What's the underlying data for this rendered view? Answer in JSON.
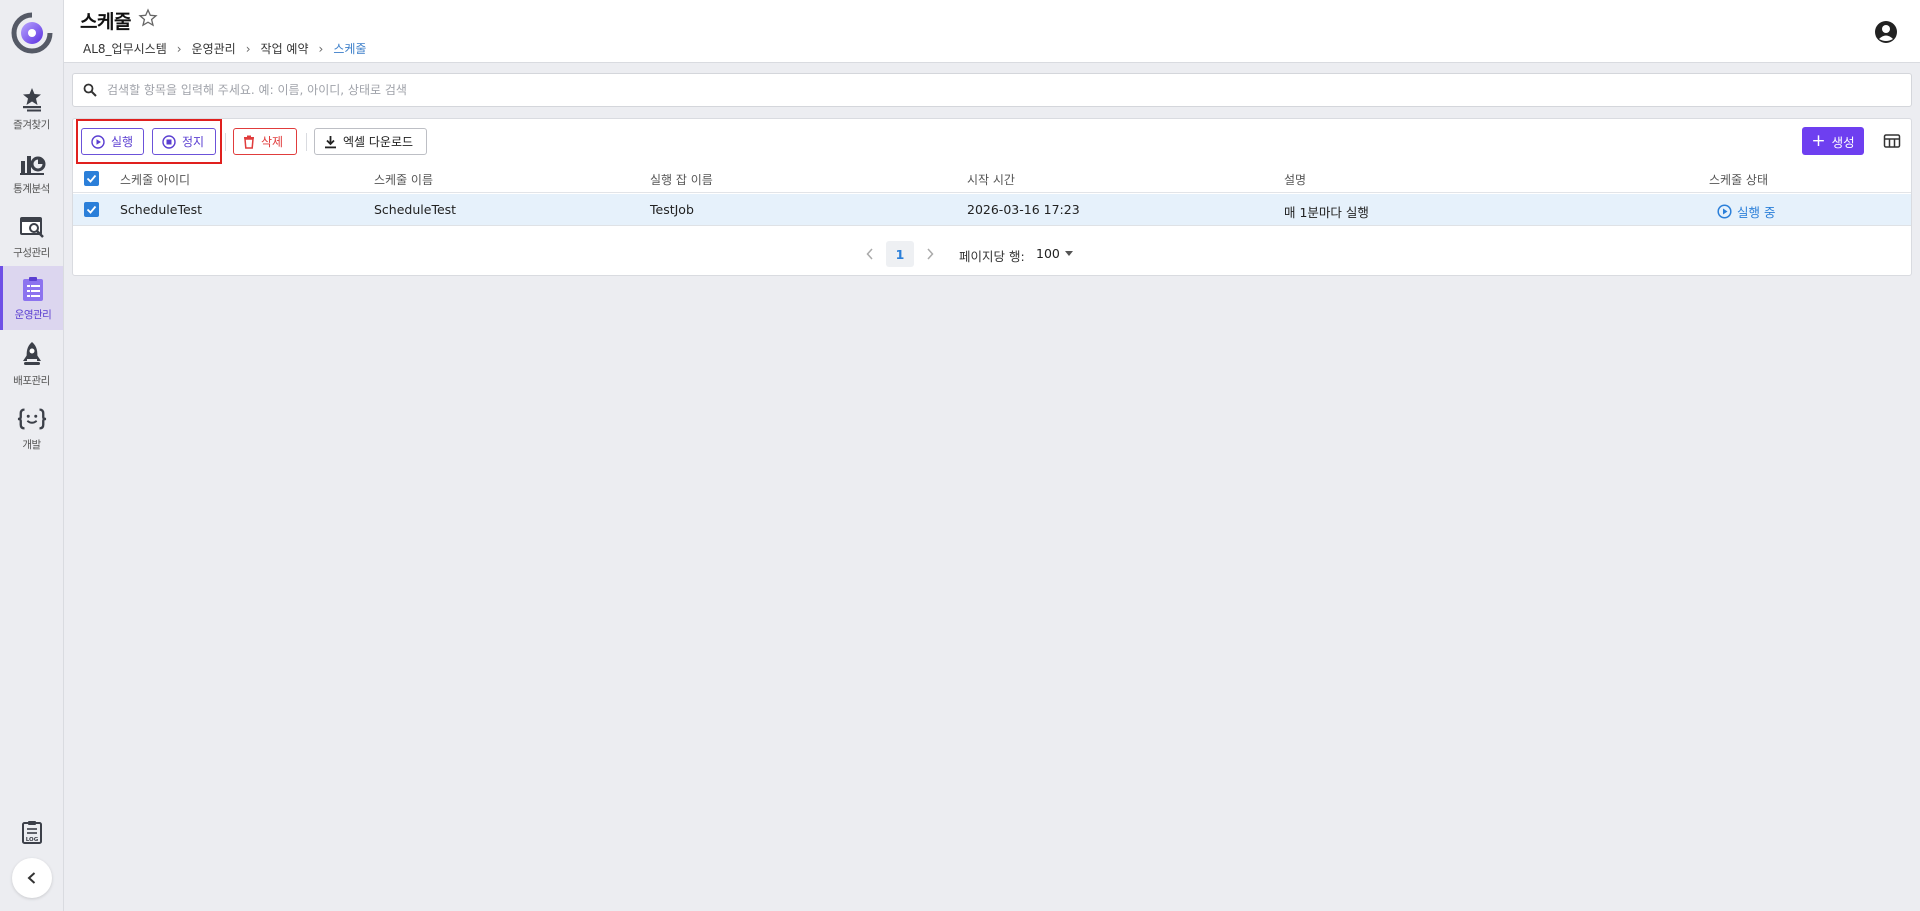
{
  "sidebar": {
    "items": [
      {
        "label": "즐겨찾기",
        "icon": "favorites-icon"
      },
      {
        "label": "통계분석",
        "icon": "statistics-icon"
      },
      {
        "label": "구성관리",
        "icon": "configuration-icon"
      },
      {
        "label": "운영관리",
        "icon": "operations-icon",
        "active": true
      },
      {
        "label": "배포관리",
        "icon": "rocket-icon"
      },
      {
        "label": "개발",
        "icon": "code-braces-icon"
      }
    ]
  },
  "header": {
    "title": "스케줄",
    "breadcrumb": [
      "AL8_업무시스템",
      "운영관리",
      "작업 예약",
      "스케줄"
    ]
  },
  "search": {
    "placeholder": "검색할 항목을 입력해 주세요. 예: 이름, 아이디, 상태로 검색"
  },
  "toolbar": {
    "run_label": "실행",
    "stop_label": "정지",
    "delete_label": "삭제",
    "excel_label": "엑셀 다운로드",
    "create_label": "생성"
  },
  "table": {
    "columns": [
      "스케줄 아이디",
      "스케줄 이름",
      "실행 잡 이름",
      "시작 시간",
      "설명",
      "스케줄 상태"
    ],
    "rows": [
      {
        "id": "ScheduleTest",
        "name": "ScheduleTest",
        "job": "TestJob",
        "start": "2026-03-16 17:23",
        "desc": "매 1분마다 실행",
        "status": "실행 중",
        "checked": true
      }
    ]
  },
  "pagination": {
    "current_page": "1",
    "rows_per_page_label": "페이지당 행:",
    "rows_per_page": "100"
  },
  "colors": {
    "accent": "#6e3ff0",
    "link": "#2b7fd9",
    "danger": "#e03c3c",
    "highlight": "#e0201e"
  }
}
